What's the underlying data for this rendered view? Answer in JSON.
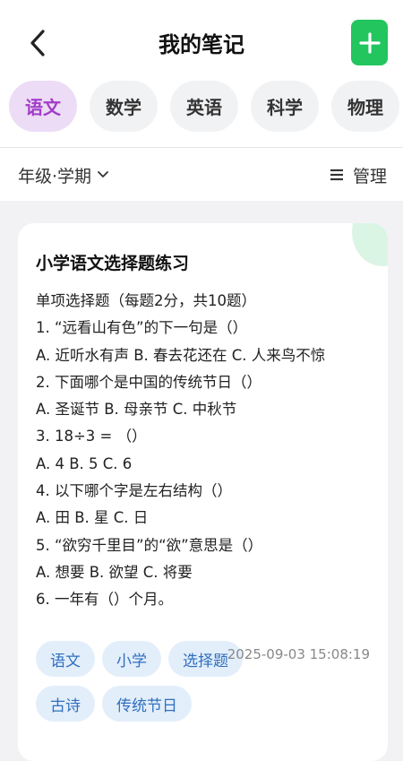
{
  "header": {
    "title": "我的笔记",
    "back_icon": "chevron-left-icon",
    "add_icon": "plus-icon",
    "add_color": "#22c55e"
  },
  "tabs": [
    {
      "label": "语文",
      "active": true
    },
    {
      "label": "数学",
      "active": false
    },
    {
      "label": "英语",
      "active": false
    },
    {
      "label": "科学",
      "active": false
    },
    {
      "label": "物理",
      "active": false
    }
  ],
  "filter": {
    "label": "年级·学期",
    "icon": "chevron-down-icon"
  },
  "manage": {
    "label": "管理",
    "icon": "menu-icon"
  },
  "note": {
    "title": "小学语文选择题练习",
    "lines": [
      "单项选择题（每题2分，共10题）",
      "1. “远看山有色”的下一句是（）",
      "A. 近听水有声  B. 春去花还在  C. 人来鸟不惊",
      "2. 下面哪个是中国的传统节日（）",
      "A. 圣诞节  B. 母亲节  C. 中秋节",
      "3. 18÷3 = （）",
      "A. 4  B. 5  C. 6",
      "4. 以下哪个字是左右结构（）",
      "A. 田  B. 星  C. 日",
      "5. “欲穷千里目”的“欲”意思是（）",
      "A. 想要  B. 欲望  C. 将要",
      "6. 一年有（）个月。"
    ],
    "tags": [
      "语文",
      "小学",
      "选择题",
      "古诗",
      "传统节日"
    ],
    "timestamp": "2025-09-03 15:08:19"
  }
}
